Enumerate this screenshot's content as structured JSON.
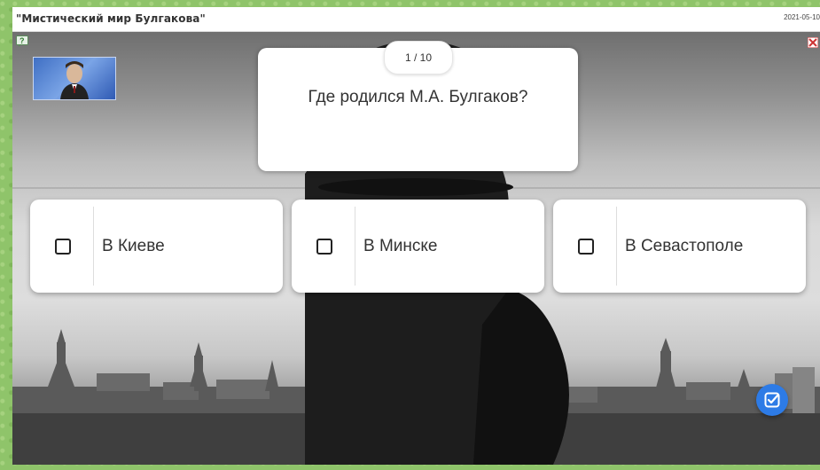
{
  "header": {
    "title": "\"Мистический мир Булгакова\"",
    "date": "2021-05-10"
  },
  "quiz": {
    "counter": "1 / 10",
    "question": "Где родился М.А. Булгаков?",
    "answers": [
      {
        "label": "В Киеве",
        "checked": false
      },
      {
        "label": "В Минске",
        "checked": false
      },
      {
        "label": "В Севастополе",
        "checked": false
      }
    ]
  },
  "colors": {
    "accent": "#2d7be6",
    "card": "#ffffff",
    "text": "#333333"
  },
  "icons": {
    "help": "help-icon",
    "close": "close-icon",
    "submit": "check-submit-icon"
  }
}
